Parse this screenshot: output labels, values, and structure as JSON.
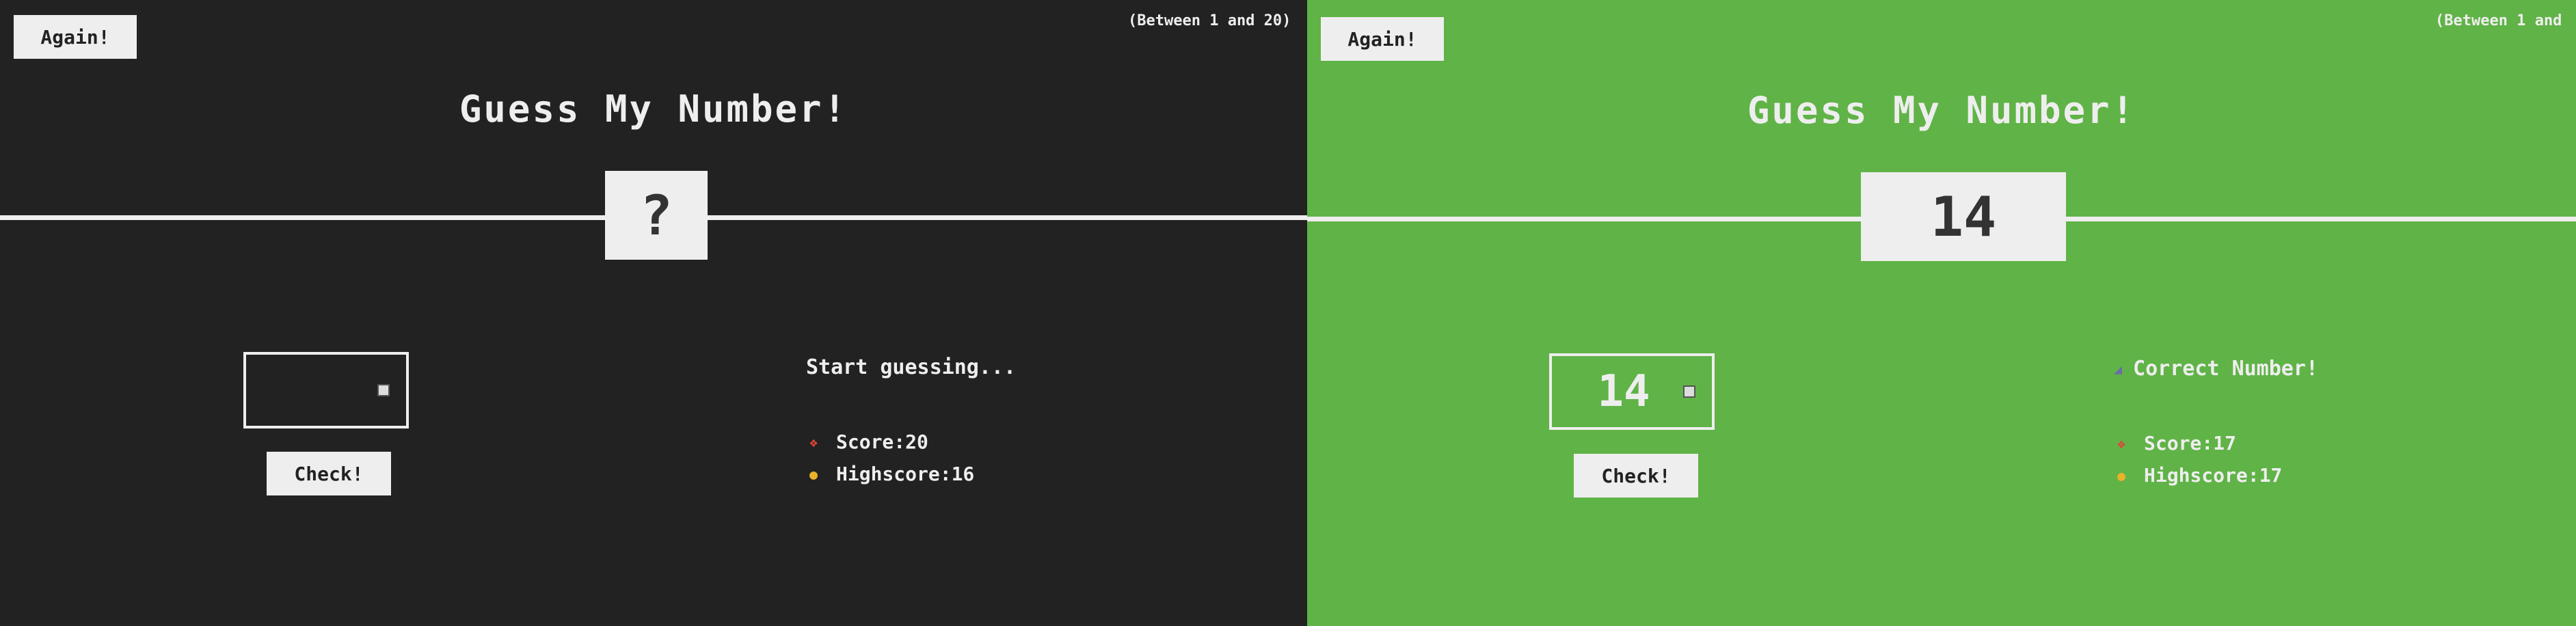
{
  "left": {
    "again_label": "Again!",
    "between_text": "(Between 1 and 20)",
    "title": "Guess My Number!",
    "secret_number": "?",
    "guess_value": "",
    "check_label": "Check!",
    "message": "Start guessing...",
    "score_label": "Score: ",
    "score": "20",
    "highscore_label": "Highscore: ",
    "highscore": "16",
    "background_color": "#222222"
  },
  "right": {
    "again_label": "Again!",
    "between_text": "(Between 1 and",
    "title": "Guess My Number!",
    "secret_number": "14",
    "guess_value": "14",
    "check_label": "Check!",
    "message_icon": "party-popper-icon",
    "message": "Correct Number!",
    "score_label": "Score: ",
    "score": "17",
    "highscore_label": "Highscore: ",
    "highscore": "17",
    "background_color": "#60b347"
  },
  "icons": {
    "score": "100-points-icon",
    "highscore": "medal-icon"
  }
}
